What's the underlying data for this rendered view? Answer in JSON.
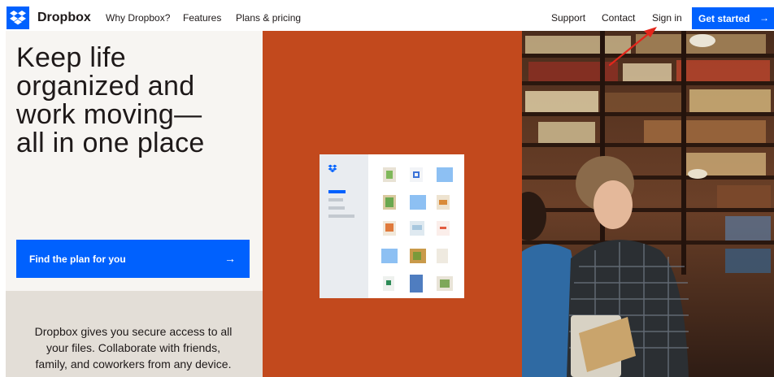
{
  "nav": {
    "brand": "Dropbox",
    "links": [
      "Why Dropbox?",
      "Features",
      "Plans & pricing"
    ],
    "right_links": [
      "Support",
      "Contact",
      "Sign in"
    ],
    "cta_label": "Get started",
    "cta_arrow": "→"
  },
  "hero": {
    "headline_lines": [
      "Keep life",
      "organized and",
      "work moving—",
      "all in one place"
    ],
    "plan_button_label": "Find the plan for you",
    "plan_button_arrow": "→",
    "description": "Dropbox gives you secure access to all your files. Collaborate with friends, family, and coworkers from any device."
  },
  "colors": {
    "brand_blue": "#0061fe",
    "panel_orange": "#c2491d",
    "panel_cream": "#f7f5f2",
    "panel_beige": "#e3ded7",
    "annotation_red": "#e3261b"
  },
  "icons": [
    "dropbox-logo-icon",
    "arrow-right-icon",
    "annotation-arrow-icon"
  ]
}
